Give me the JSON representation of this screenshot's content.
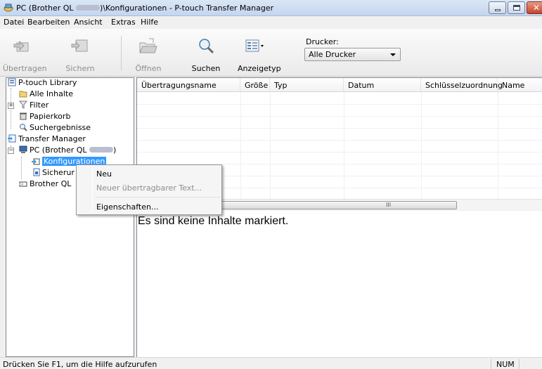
{
  "window": {
    "title_prefix": "PC (Brother QL",
    "title_suffix": ")\\Konfigurationen - P-touch Transfer Manager"
  },
  "menu": [
    "Datei",
    "Bearbeiten",
    "Ansicht",
    "Extras",
    "Hilfe"
  ],
  "toolbar": {
    "uebertragen": "Übertragen",
    "sichern": "Sichern",
    "oeffnen": "Öffnen",
    "suchen": "Suchen",
    "anzeigetyp": "Anzeigetyp",
    "drucker_label": "Drucker:",
    "drucker_value": "Alle Drucker"
  },
  "tree": {
    "library": "P-touch Library",
    "alle_inhalte": "Alle Inhalte",
    "filter": "Filter",
    "papierkorb": "Papierkorb",
    "suchergebnisse": "Suchergebnisse",
    "transfer_manager": "Transfer Manager",
    "pc_prefix": "PC (Brother QL",
    "pc_suffix": ")",
    "konfigurationen": "Konfigurationen",
    "sicherung": "Sicherur",
    "brother": "Brother QL"
  },
  "list": {
    "columns": [
      "Übertragungsname",
      "Größe",
      "Typ",
      "Datum",
      "Schlüsselzuordnung",
      "Name"
    ]
  },
  "preview": {
    "message": "Es sind keine Inhalte markiert."
  },
  "context_menu": {
    "neu": "Neu",
    "neuer_text": "Neuer übertragbarer Text...",
    "eigenschaften": "Eigenschaften..."
  },
  "status": {
    "help": "Drücken Sie F1, um die Hilfe aufzurufen",
    "num": "NUM"
  }
}
